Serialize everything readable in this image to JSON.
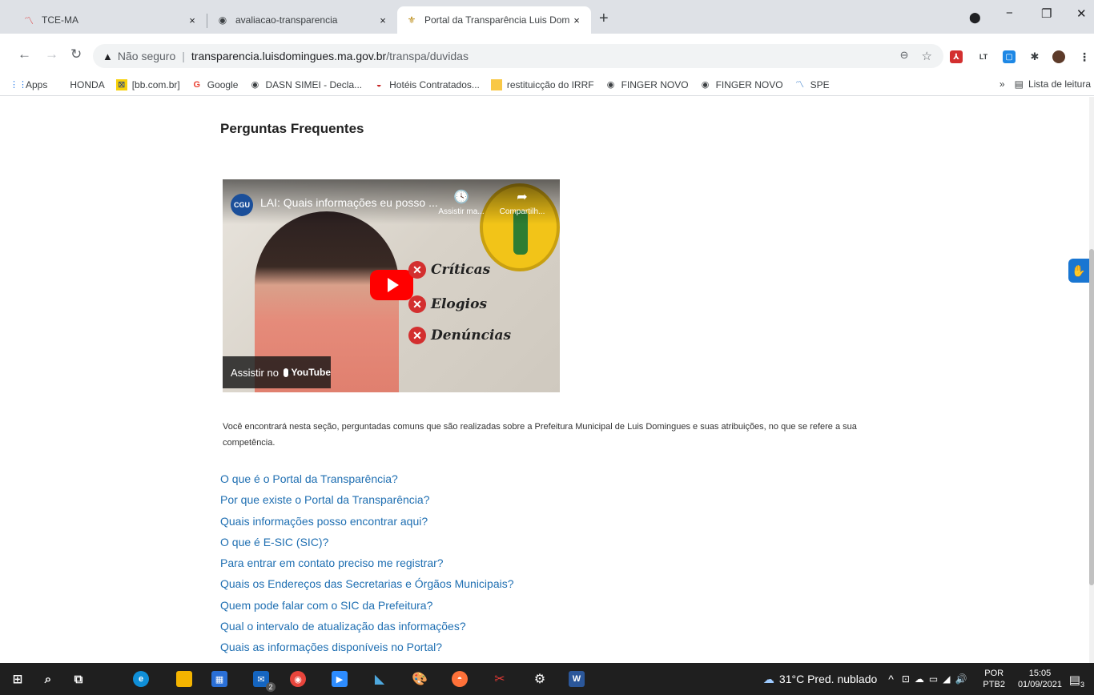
{
  "browser": {
    "tabs": [
      {
        "title": "TCE-MA",
        "icon": "chart-line-icon",
        "active": false
      },
      {
        "title": "avaliacao-transparencia",
        "icon": "globe-icon",
        "active": false
      },
      {
        "title": "Portal da Transparência Luis Dom",
        "icon": "city-crest-icon",
        "active": true
      }
    ],
    "tab_close": "×",
    "new_tab": "+",
    "window_controls": {
      "minimize": "−",
      "restore": "❐",
      "close": "✕"
    },
    "nav": {
      "back": "←",
      "forward": "→",
      "reload": "↻"
    },
    "address": {
      "warning_icon": "▲",
      "security_label": "Não seguro",
      "separator": "|",
      "host": "transparencia.luisdomingues.ma.gov.br",
      "path": "/transpa/duvidas"
    },
    "address_icons": {
      "zoom": "🔍",
      "bookmark_star": "☆"
    },
    "extensions": [
      {
        "name": "pdf-extension-icon",
        "label": "",
        "color": "#d32f2f"
      },
      {
        "name": "lt-extension-icon",
        "label": "LT",
        "color": "#3c4043"
      },
      {
        "name": "tab-extension-icon",
        "label": "",
        "color": "#1e88e5"
      },
      {
        "name": "puzzle-extension-icon",
        "label": "",
        "color": "#3c4043"
      }
    ],
    "bookmarks": [
      {
        "label": "Apps",
        "icon": "apps-grid-icon"
      },
      {
        "label": "HONDA",
        "icon": ""
      },
      {
        "label": "[bb.com.br]",
        "icon": "bb-logo-icon"
      },
      {
        "label": "Google",
        "icon": "google-g-icon"
      },
      {
        "label": "DASN SIMEI - Decla...",
        "icon": "globe-icon"
      },
      {
        "label": "Hotéis Contratados...",
        "icon": "hotel-icon"
      },
      {
        "label": "restituicção do IRRF",
        "icon": "folder-icon"
      },
      {
        "label": "FINGER NOVO",
        "icon": "globe-icon"
      },
      {
        "label": "FINGER NOVO",
        "icon": "globe-icon"
      },
      {
        "label": "SPE",
        "icon": "chart-line-icon"
      }
    ],
    "bookmarks_overflow": "»",
    "reading_list": "Lista de leitura"
  },
  "page": {
    "title": "Perguntas Frequentes",
    "video": {
      "channel_badge": "CGU",
      "title": "LAI: Quais informações eu posso ...",
      "watch_later": "Assistir ma...",
      "share": "Compartilh...",
      "items": [
        "Críticas",
        "Elogios",
        "Denúncias"
      ],
      "watch_on": "Assistir no",
      "youtube": "YouTube"
    },
    "description": "Você encontrará nesta seção, perguntadas comuns que são realizadas sobre a Prefeitura Municipal de Luis Domingues  e suas atribuições, no que se refere a sua competência.",
    "faq": [
      "O que é o Portal da Transparência?",
      "Por que existe o Portal da Transparência?",
      "Quais informações posso encontrar aqui?",
      "O que é E-SIC (SIC)?",
      "Para entrar em contato preciso me registrar?",
      "Quais os Endereços das Secretarias e Órgãos Municipais?",
      "Quem pode falar com o SIC da Prefeitura?",
      "Qual o intervalo de atualização das informações?",
      "Quais as informações disponíveis no Portal?"
    ],
    "link_color": "#1f6fb2"
  },
  "taskbar": {
    "weather": "31°C  Pred. nublado",
    "tray_arrow": "^",
    "language": "POR",
    "layout": "PTB2",
    "time": "15:05",
    "date": "01/09/2021",
    "notification_count": "3",
    "badge_count": "2"
  }
}
